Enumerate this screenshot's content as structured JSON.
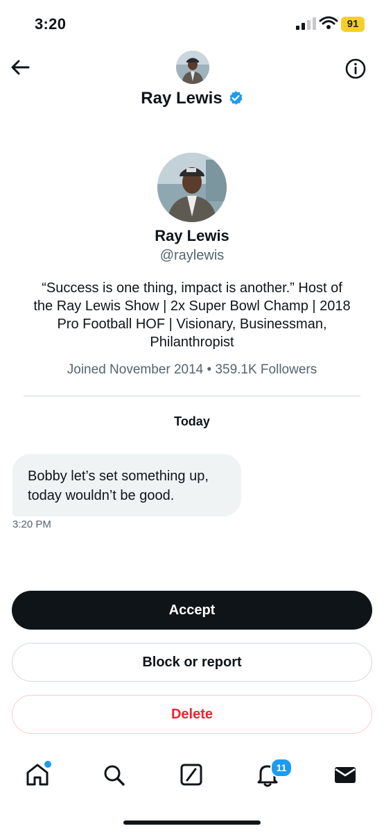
{
  "status_bar": {
    "time": "3:20",
    "battery": "91"
  },
  "header": {
    "name": "Ray Lewis"
  },
  "profile": {
    "name": "Ray Lewis",
    "handle": "@raylewis",
    "bio_lines": [
      "“Success is one thing, impact is another.” Host of",
      "the Ray Lewis Show | 2x Super Bowl Champ | 2018",
      "Pro Football HOF | Visionary, Businessman,",
      "Philanthropist"
    ],
    "meta": "Joined November 2014 • 359.1K Followers"
  },
  "conversation": {
    "day_label": "Today",
    "message_lines": [
      "Bobby let’s set something up,",
      "today wouldn’t be good."
    ],
    "timestamp": "3:20 PM"
  },
  "actions": {
    "accept": "Accept",
    "block": "Block or report",
    "delete": "Delete"
  },
  "tab_bar": {
    "notifications_count": "11"
  },
  "icons": [
    "back-arrow-icon",
    "info-icon",
    "verified-badge-icon",
    "home-icon",
    "search-icon",
    "compose-icon",
    "bell-icon",
    "mail-icon"
  ],
  "colors": {
    "accent": "#1d9bf0",
    "delete": "#f4212e",
    "text": "#0f1419",
    "muted": "#536471"
  }
}
